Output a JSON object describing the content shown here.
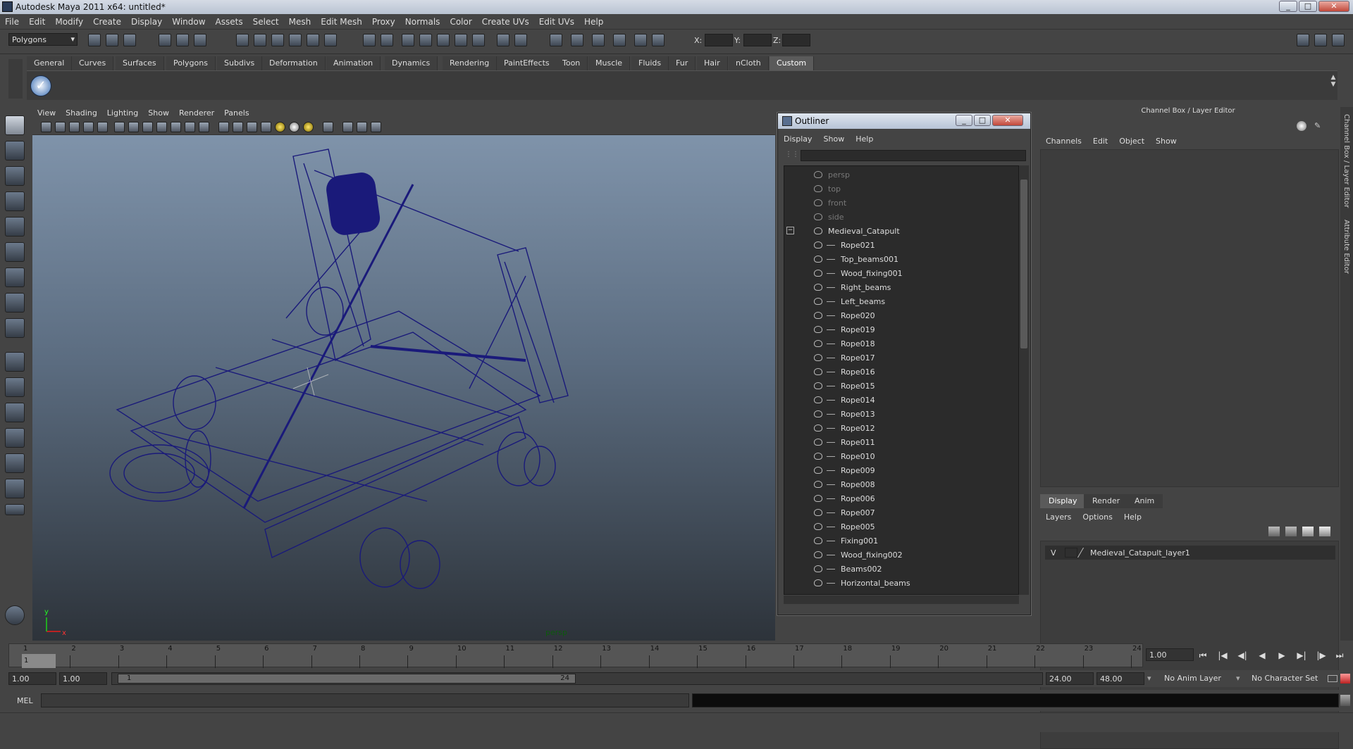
{
  "window": {
    "title": "Autodesk Maya 2011 x64: untitled*",
    "controls": [
      "_",
      "□",
      "✕"
    ]
  },
  "menubar": [
    "File",
    "Edit",
    "Modify",
    "Create",
    "Display",
    "Window",
    "Assets",
    "Select",
    "Mesh",
    "Edit Mesh",
    "Proxy",
    "Normals",
    "Color",
    "Create UVs",
    "Edit UVs",
    "Help"
  ],
  "statusline": {
    "mode": "Polygons",
    "x_label": "X:",
    "y_label": "Y:",
    "z_label": "Z:"
  },
  "shelf_tabs": [
    "General",
    "Curves",
    "Surfaces",
    "Polygons",
    "Subdivs",
    "Deformation",
    "Animation",
    "Dynamics",
    "Rendering",
    "PaintEffects",
    "Toon",
    "Muscle",
    "Fluids",
    "Fur",
    "Hair",
    "nCloth",
    "Custom"
  ],
  "active_shelf_tab": "Custom",
  "viewport": {
    "menu": [
      "View",
      "Shading",
      "Lighting",
      "Show",
      "Renderer",
      "Panels"
    ],
    "camera": "persp",
    "axis_y": "y",
    "axis_x": "x",
    "wire_color": "#1a1a7a"
  },
  "outliner": {
    "title": "Outliner",
    "menu": [
      "Display",
      "Show",
      "Help"
    ],
    "cameras": [
      "persp",
      "top",
      "front",
      "side"
    ],
    "group": "Medieval_Catapult",
    "children": [
      "Rope021",
      "Top_beams001",
      "Wood_fixing001",
      "Right_beams",
      "Left_beams",
      "Rope020",
      "Rope019",
      "Rope018",
      "Rope017",
      "Rope016",
      "Rope015",
      "Rope014",
      "Rope013",
      "Rope012",
      "Rope011",
      "Rope010",
      "Rope009",
      "Rope008",
      "Rope006",
      "Rope007",
      "Rope005",
      "Fixing001",
      "Wood_fixing002",
      "Beams002",
      "Horizontal_beams"
    ]
  },
  "channelbox": {
    "title": "Channel Box / Layer Editor",
    "menu": [
      "Channels",
      "Edit",
      "Object",
      "Show"
    ],
    "layer_tabs": [
      "Display",
      "Render",
      "Anim"
    ],
    "active_layer_tab": "Display",
    "layer_menu": [
      "Layers",
      "Options",
      "Help"
    ],
    "layer": {
      "visible": "V",
      "name": "Medieval_Catapult_layer1"
    },
    "side_tabs": [
      "Channel Box / Layer Editor",
      "Attribute Editor"
    ]
  },
  "timeline": {
    "ticks": [
      "1",
      "2",
      "3",
      "4",
      "5",
      "6",
      "7",
      "8",
      "9",
      "10",
      "11",
      "12",
      "13",
      "14",
      "15",
      "16",
      "17",
      "18",
      "19",
      "20",
      "21",
      "22",
      "23",
      "24"
    ],
    "current_frame": "1.00",
    "current_marker": "1"
  },
  "range": {
    "start": "1.00",
    "playback_start": "1.00",
    "slider_start": "1",
    "slider_end": "24",
    "playback_end": "24.00",
    "end": "48.00",
    "anim_layer": "No Anim Layer",
    "char_set": "No Character Set"
  },
  "command": {
    "label": "MEL"
  }
}
